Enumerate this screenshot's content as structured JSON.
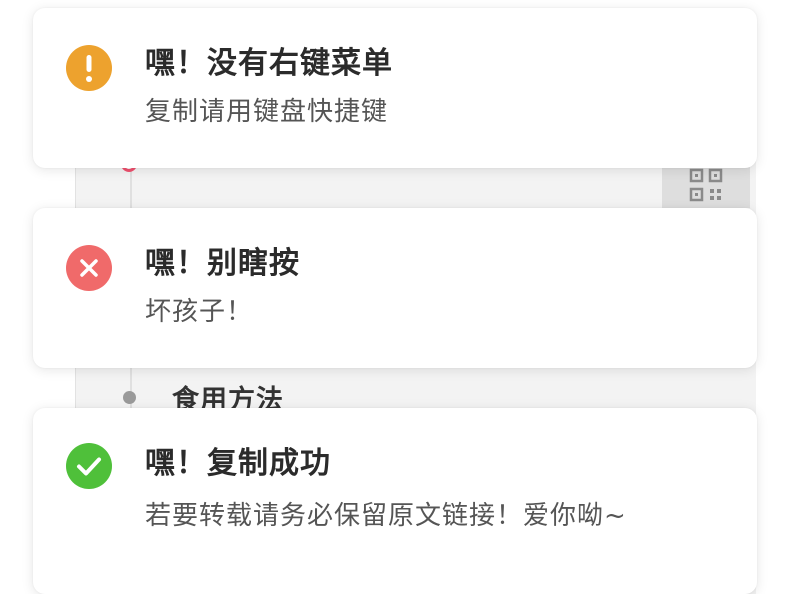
{
  "colors": {
    "warning": "#eda22e",
    "error": "#f06a6a",
    "success": "#4fc03a",
    "title": "#2b2b2b",
    "message": "#555555",
    "accent_ring": "#f0506e"
  },
  "background": {
    "section_label": "食用方法",
    "qr_icon": "qr-code-icon"
  },
  "notifications": [
    {
      "type": "warning",
      "icon": "exclamation-icon",
      "title": "嘿！没有右键菜单",
      "message": "复制请用键盘快捷键"
    },
    {
      "type": "error",
      "icon": "close-icon",
      "title": "嘿！别瞎按",
      "message": "坏孩子！"
    },
    {
      "type": "success",
      "icon": "check-icon",
      "title": "嘿！复制成功",
      "message": "若要转载请务必保留原文链接！爱你呦~"
    }
  ]
}
